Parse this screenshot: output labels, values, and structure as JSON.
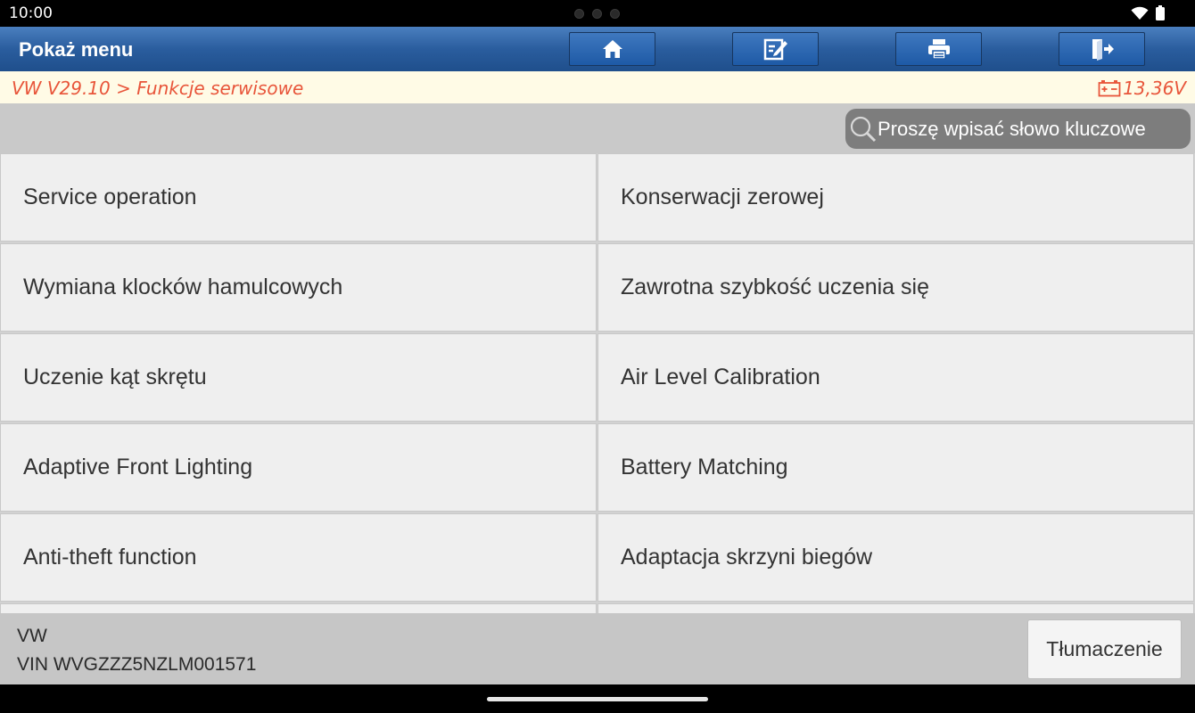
{
  "status_bar": {
    "time": "10:00"
  },
  "titlebar": {
    "title": "Pokaż menu"
  },
  "breadcrumb": {
    "path": "VW V29.10 > Funkcje serwisowe",
    "voltage": "13,36V"
  },
  "search": {
    "placeholder": "Proszę wpisać słowo kluczowe"
  },
  "menu_items": [
    {
      "label": "Service operation"
    },
    {
      "label": "Konserwacji zerowej"
    },
    {
      "label": "Wymiana klocków hamulcowych"
    },
    {
      "label": "Zawrotna szybkość uczenia się"
    },
    {
      "label": "Uczenie kąt skrętu"
    },
    {
      "label": "Air Level Calibration"
    },
    {
      "label": "Adaptive Front Lighting"
    },
    {
      "label": "Battery Matching"
    },
    {
      "label": "Anti-theft function"
    },
    {
      "label": "Adaptacja skrzyni biegów"
    }
  ],
  "footer": {
    "make": "VW",
    "vin": "VIN WVGZZZ5NZLM001571",
    "translate_label": "Tłumaczenie"
  },
  "colors": {
    "titlebar": "#2a5d9e",
    "accent_text": "#e8553a",
    "breadcrumb_bg": "#fffbe6"
  }
}
